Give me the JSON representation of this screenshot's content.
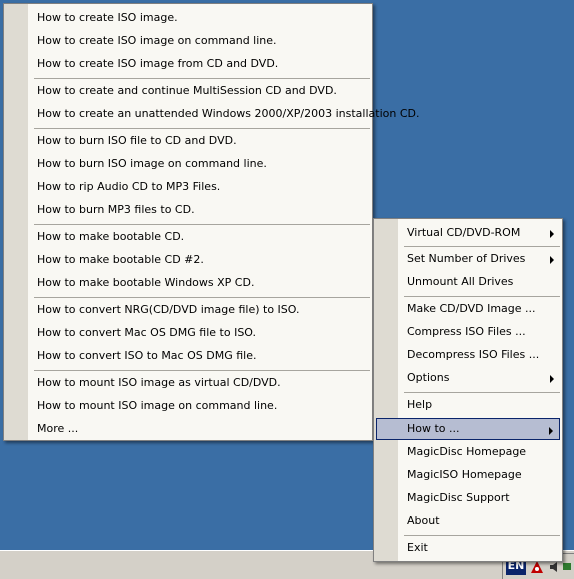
{
  "how_to_menu": {
    "items": [
      {
        "label": "How to create ISO image."
      },
      {
        "label": "How to create ISO image on command line."
      },
      {
        "label": "How to create ISO image from CD and DVD."
      },
      {
        "label": "How to create and continue MultiSession CD and DVD."
      },
      {
        "label": "How to create an unattended Windows 2000/XP/2003 installation CD."
      },
      {
        "label": "How to burn ISO file to CD and DVD."
      },
      {
        "label": "How to burn ISO image on command line."
      },
      {
        "label": "How to rip Audio CD to MP3 Files."
      },
      {
        "label": "How to burn MP3 files to CD."
      },
      {
        "label": "How to make bootable CD."
      },
      {
        "label": "How to make bootable CD #2."
      },
      {
        "label": "How to make bootable Windows XP CD."
      },
      {
        "label": "How to convert NRG(CD/DVD image file) to ISO."
      },
      {
        "label": "How to convert Mac OS DMG file to ISO."
      },
      {
        "label": "How to convert ISO to Mac OS DMG file."
      },
      {
        "label": "How to mount ISO image as virtual CD/DVD."
      },
      {
        "label": "How to mount ISO image on command line."
      },
      {
        "label": "More ..."
      }
    ]
  },
  "main_menu": {
    "items": [
      {
        "label": "Virtual CD/DVD-ROM",
        "submenu": true
      },
      {
        "label": "Set Number of Drives",
        "submenu": true
      },
      {
        "label": "Unmount All Drives"
      },
      {
        "label": "Make CD/DVD Image ..."
      },
      {
        "label": "Compress ISO Files ..."
      },
      {
        "label": "Decompress ISO Files ..."
      },
      {
        "label": "Options",
        "submenu": true
      },
      {
        "label": "Help"
      },
      {
        "label": "How to ...",
        "submenu": true,
        "highlighted": true
      },
      {
        "label": "MagicDisc Homepage"
      },
      {
        "label": "MagicISO Homepage"
      },
      {
        "label": "MagicDisc Support"
      },
      {
        "label": "About"
      },
      {
        "label": "Exit"
      }
    ]
  },
  "taskbar": {
    "language": "EN"
  },
  "colors": {
    "desktop": "#3a6ea5",
    "menu_bg": "#f9f8f3",
    "gutter": "#dedbd2",
    "highlight": "#b6bdd2"
  }
}
